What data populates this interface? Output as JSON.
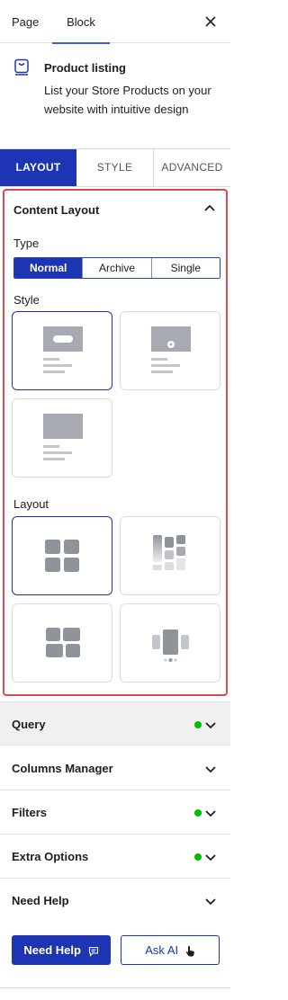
{
  "top_tabs": {
    "page": "Page",
    "block": "Block"
  },
  "block": {
    "title": "Product listing",
    "description": "List your Store Products on your website with intuitive design",
    "icon": "store-listing-icon"
  },
  "main_tabs": {
    "layout": "LAYOUT",
    "style": "STYLE",
    "advanced": "ADVANCED"
  },
  "content_layout": {
    "title": "Content Layout",
    "type_label": "Type",
    "type_options": [
      "Normal",
      "Archive",
      "Single"
    ],
    "type_selected": "Normal",
    "style_label": "Style",
    "layout_label": "Layout"
  },
  "accordions": {
    "query": "Query",
    "columns_manager": "Columns Manager",
    "filters": "Filters",
    "extra_options": "Extra Options",
    "need_help": "Need Help"
  },
  "buttons": {
    "need_help": "Need Help",
    "ask_ai": "Ask AI"
  },
  "colors": {
    "primary": "#1d35b5",
    "highlight_border": "#e04a51",
    "status_dot": "#00c000"
  }
}
